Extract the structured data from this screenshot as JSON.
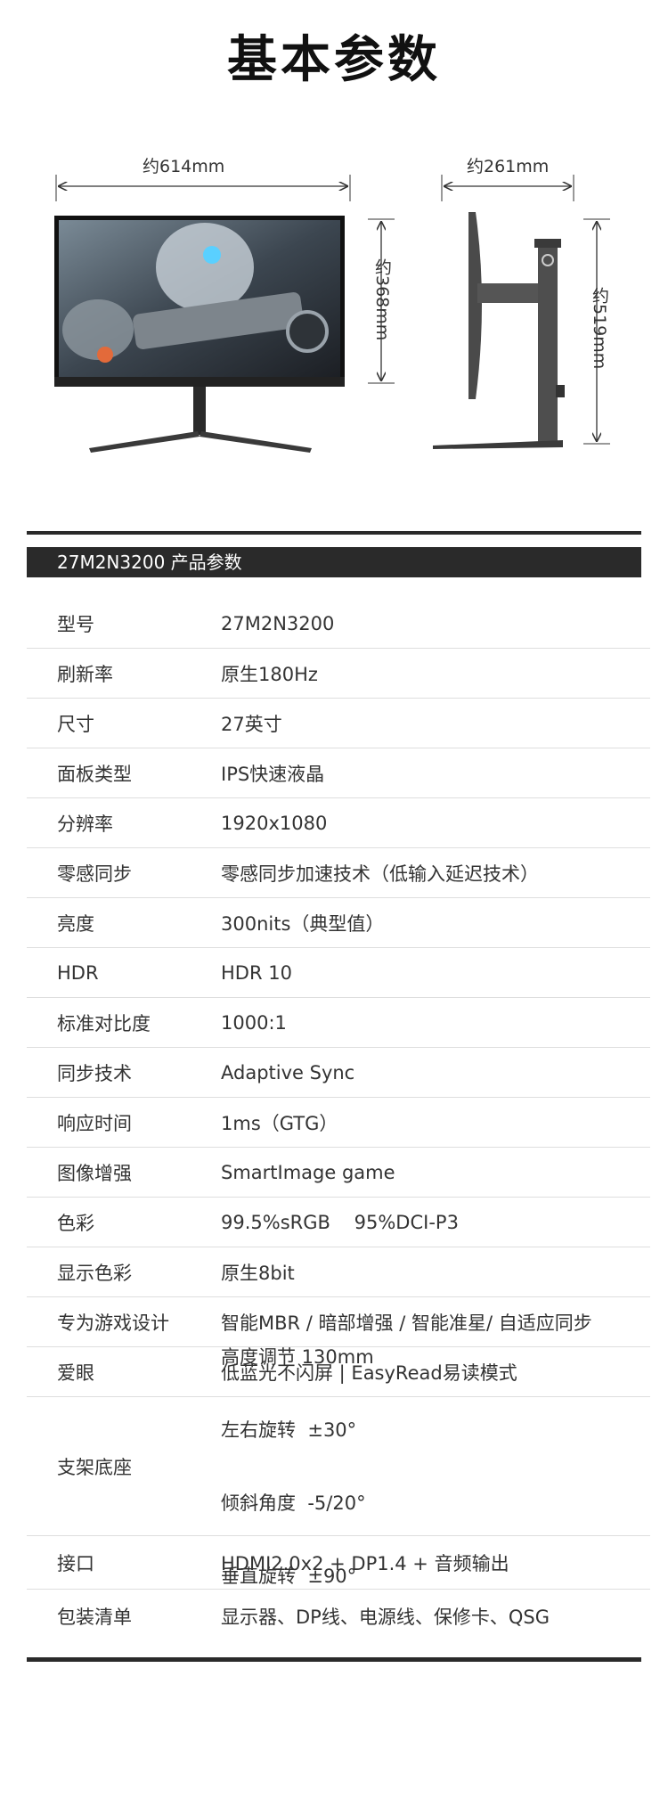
{
  "title": "基本参数",
  "dimensions": {
    "width": "约614mm",
    "height": "约368mm",
    "depth": "约261mm",
    "max_height": "约519mm"
  },
  "section_title": "27M2N3200 产品参数",
  "specs": [
    {
      "label": "型号",
      "value": "27M2N3200"
    },
    {
      "label": "刷新率",
      "value": "原生180Hz"
    },
    {
      "label": "尺寸",
      "value": "27英寸"
    },
    {
      "label": "面板类型",
      "value": "IPS快速液晶"
    },
    {
      "label": "分辨率",
      "value": "1920x1080"
    },
    {
      "label": "零感同步",
      "value": "零感同步加速技术（低输入延迟技术）"
    },
    {
      "label": "亮度",
      "value": "300nits（典型值）"
    },
    {
      "label": "HDR",
      "value": "HDR 10"
    },
    {
      "label": "标准对比度",
      "value": "1000:1"
    },
    {
      "label": "同步技术",
      "value": "Adaptive Sync"
    },
    {
      "label": "响应时间",
      "value": "1ms（GTG）"
    },
    {
      "label": "图像增强",
      "value": "SmartImage game"
    },
    {
      "label": "色彩",
      "value": "99.5%sRGB    95%DCI-P3"
    },
    {
      "label": "显示色彩",
      "value": "原生8bit"
    },
    {
      "label": "专为游戏设计",
      "value": "智能MBR / 暗部增强 / 智能准星/ 自适应同步"
    },
    {
      "label": "爱眼",
      "value": "低蓝光不闪屏 | EasyRead易读模式"
    }
  ],
  "stand": {
    "label": "支架底座",
    "lines": [
      "高度调节 130mm",
      "左右旋转  ±30°",
      "倾斜角度  -5/20°",
      "垂直旋转  ±90°"
    ]
  },
  "ports": {
    "label": "接口",
    "value": "HDMI2.0x2 + DP1.4 + 音频输出"
  },
  "package": {
    "label": "包装清单",
    "value": "显示器、DP线、电源线、保修卡、QSG"
  }
}
